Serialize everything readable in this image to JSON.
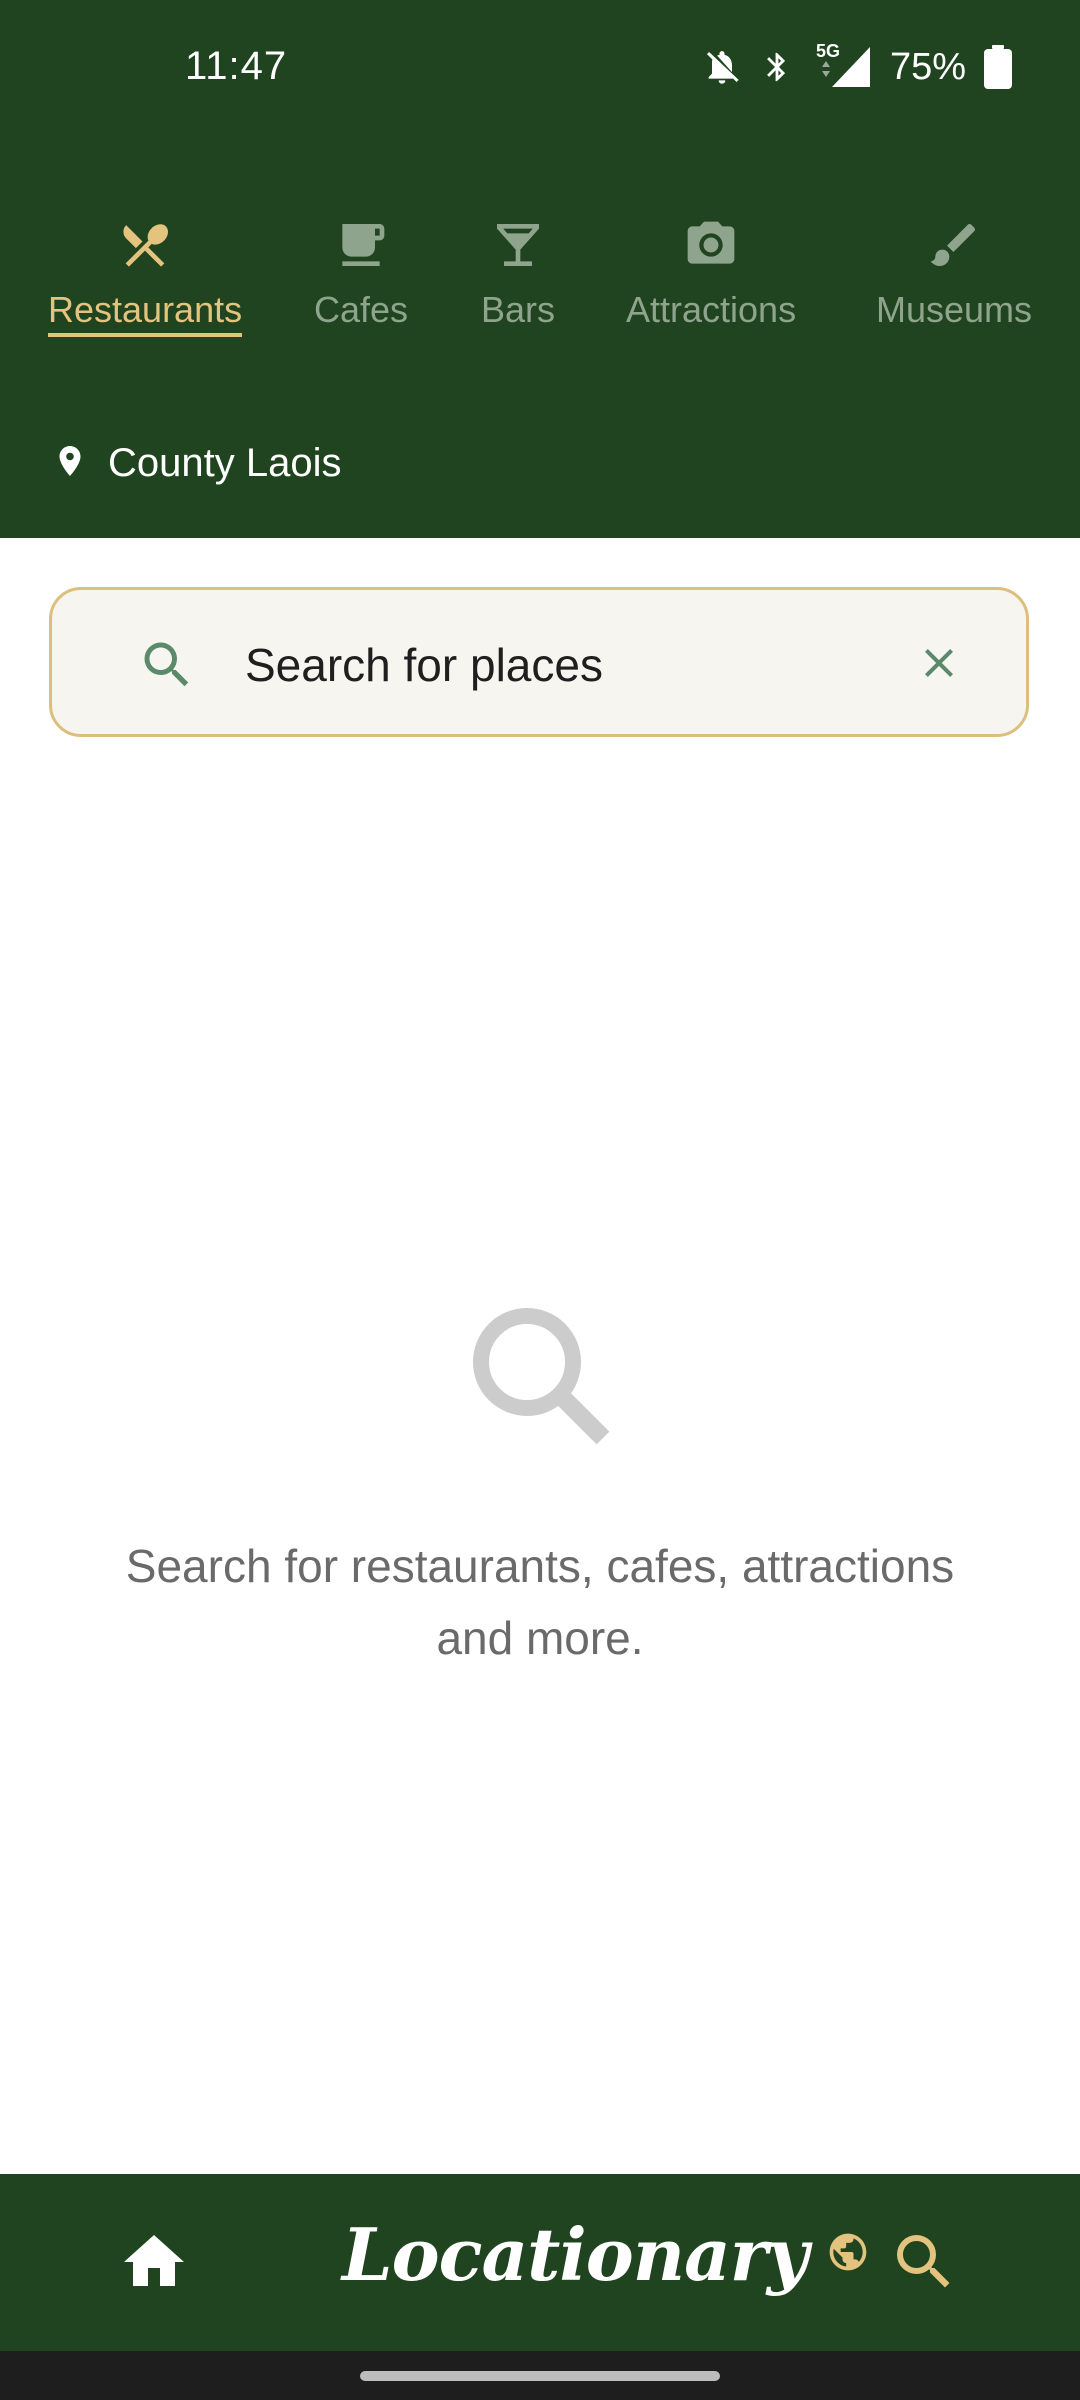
{
  "status_bar": {
    "time": "11:47",
    "network": "5G",
    "battery": "75%",
    "icons": [
      "bell-off-icon",
      "bluetooth-icon",
      "signal-icon",
      "battery-icon"
    ]
  },
  "categories": {
    "active_color": "#e3c37e",
    "inactive_color": "#8fa48d",
    "items": [
      {
        "label": "Restaurants",
        "icon": "fork-knife-icon",
        "active": true
      },
      {
        "label": "Cafes",
        "icon": "coffee-cup-icon",
        "active": false
      },
      {
        "label": "Bars",
        "icon": "cocktail-glass-icon",
        "active": false
      },
      {
        "label": "Attractions",
        "icon": "camera-icon",
        "active": false
      },
      {
        "label": "Museums",
        "icon": "paintbrush-icon",
        "active": false
      }
    ]
  },
  "location": {
    "label": "County Laois",
    "icon": "location-pin-icon"
  },
  "search": {
    "placeholder": "Search for places",
    "value": "",
    "search_icon": "search-icon",
    "clear_icon": "close-icon"
  },
  "empty_state": {
    "icon": "search-icon",
    "message": "Search for restaurants, cafes, attractions and more."
  },
  "bottom_nav": {
    "home_icon": "home-icon",
    "brand": "Locationary",
    "brand_icon": "globe-icon",
    "search_icon": "search-icon"
  },
  "theme": {
    "primary": "#20441f",
    "accent": "#e3c37e",
    "search_border": "#dcbf7d",
    "search_bg": "#f7f5f0",
    "icon_green": "#5b8a6a"
  }
}
